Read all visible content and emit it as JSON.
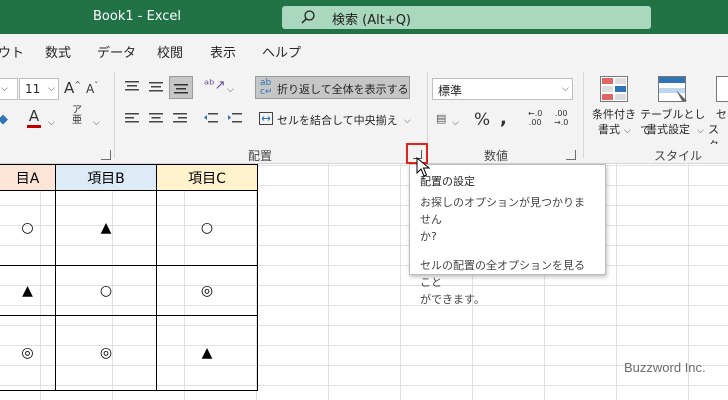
{
  "window": {
    "document_title": "Book1  -  Excel",
    "accent": "#217346"
  },
  "search": {
    "placeholder": "検索 (Alt+Q)"
  },
  "menu": {
    "tabs": [
      "ウト",
      "数式",
      "データ",
      "校閲",
      "表示",
      "ヘルプ"
    ]
  },
  "ribbon": {
    "font": {
      "size": "11"
    },
    "alignment": {
      "wrap_text_label": "折り返して全体を表示する",
      "merge_center_label": "セルを結合して中央揃え",
      "group_label": "配置"
    },
    "number": {
      "format": "標準",
      "group_label": "数値"
    },
    "styles": {
      "conditional_label": [
        "条件付き",
        "書式"
      ],
      "table_label": [
        "テーブルとして",
        "書式設定"
      ],
      "cell_styles_label": [
        "セ",
        "スタ"
      ],
      "group_label": "スタイル"
    }
  },
  "sheet": {
    "headers": [
      "目A",
      "項目B",
      "項目C"
    ],
    "rows": [
      [
        "○",
        "▲",
        "○"
      ],
      [
        "▲",
        "○",
        "◎"
      ],
      [
        "◎",
        "◎",
        "▲"
      ]
    ]
  },
  "tooltip": {
    "title": "配置の設定",
    "line1": "お探しのオプションが見つかりません",
    "line2": "か?",
    "line3": "セルの配置の全オプションを見ること",
    "line4": "ができます。"
  },
  "watermark": "Buzzword Inc."
}
